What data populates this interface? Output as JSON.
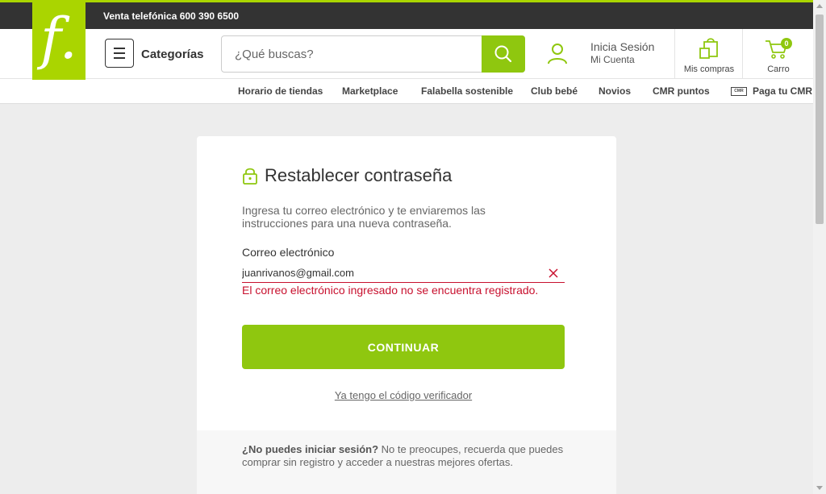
{
  "topbar": {
    "phone_text": "Venta telefónica 600 390 6500"
  },
  "brand": {
    "logo_glyph": "f.",
    "accent_color": "#aad500",
    "button_color": "#8fc70f",
    "error_color": "#c8102e"
  },
  "header": {
    "categories_label": "Categorías",
    "search_placeholder": "¿Qué buscas?",
    "login_title": "Inicia Sesión",
    "login_sub": "Mi Cuenta",
    "purchases_label": "Mis compras",
    "cart_label": "Carro",
    "cart_count": "0"
  },
  "subnav": {
    "items": [
      "Horario de tiendas",
      "Marketplace",
      "Falabella sostenible",
      "Club bebé",
      "Novios",
      "CMR puntos",
      "Paga tu CMR"
    ],
    "cmr_badge": "CMR"
  },
  "form": {
    "title": "Restablecer contraseña",
    "description": "Ingresa tu correo electrónico y te enviaremos las instrucciones para una nueva contraseña.",
    "email_label": "Correo electrónico",
    "email_value": "juanrivanos@gmail.com",
    "error_message": "El correo electrónico ingresado no se encuentra registrado.",
    "continue_label": "CONTINUAR",
    "code_link": "Ya tengo el código verificador",
    "footer_bold": "¿No puedes iniciar sesión?",
    "footer_text": " No te preocupes, recuerda que puedes comprar sin registro y acceder a nuestras mejores ofertas."
  }
}
